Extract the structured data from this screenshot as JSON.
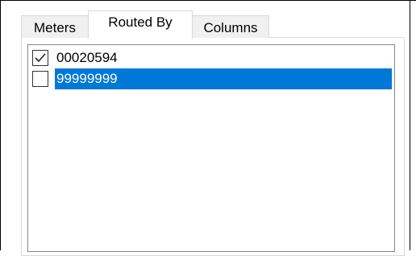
{
  "tabs": [
    {
      "label": "Meters",
      "active": false
    },
    {
      "label": "Routed By",
      "active": true
    },
    {
      "label": "Columns",
      "active": false
    }
  ],
  "routed_by_list": {
    "items": [
      {
        "label": "00020594",
        "checked": true,
        "selected": false
      },
      {
        "label": "99999999",
        "checked": false,
        "selected": true
      }
    ]
  },
  "colors": {
    "selection": "#0078d7",
    "tab_border": "#d9d9d9",
    "list_border": "#828790"
  },
  "icons": {
    "checked": "check-mark-icon"
  }
}
